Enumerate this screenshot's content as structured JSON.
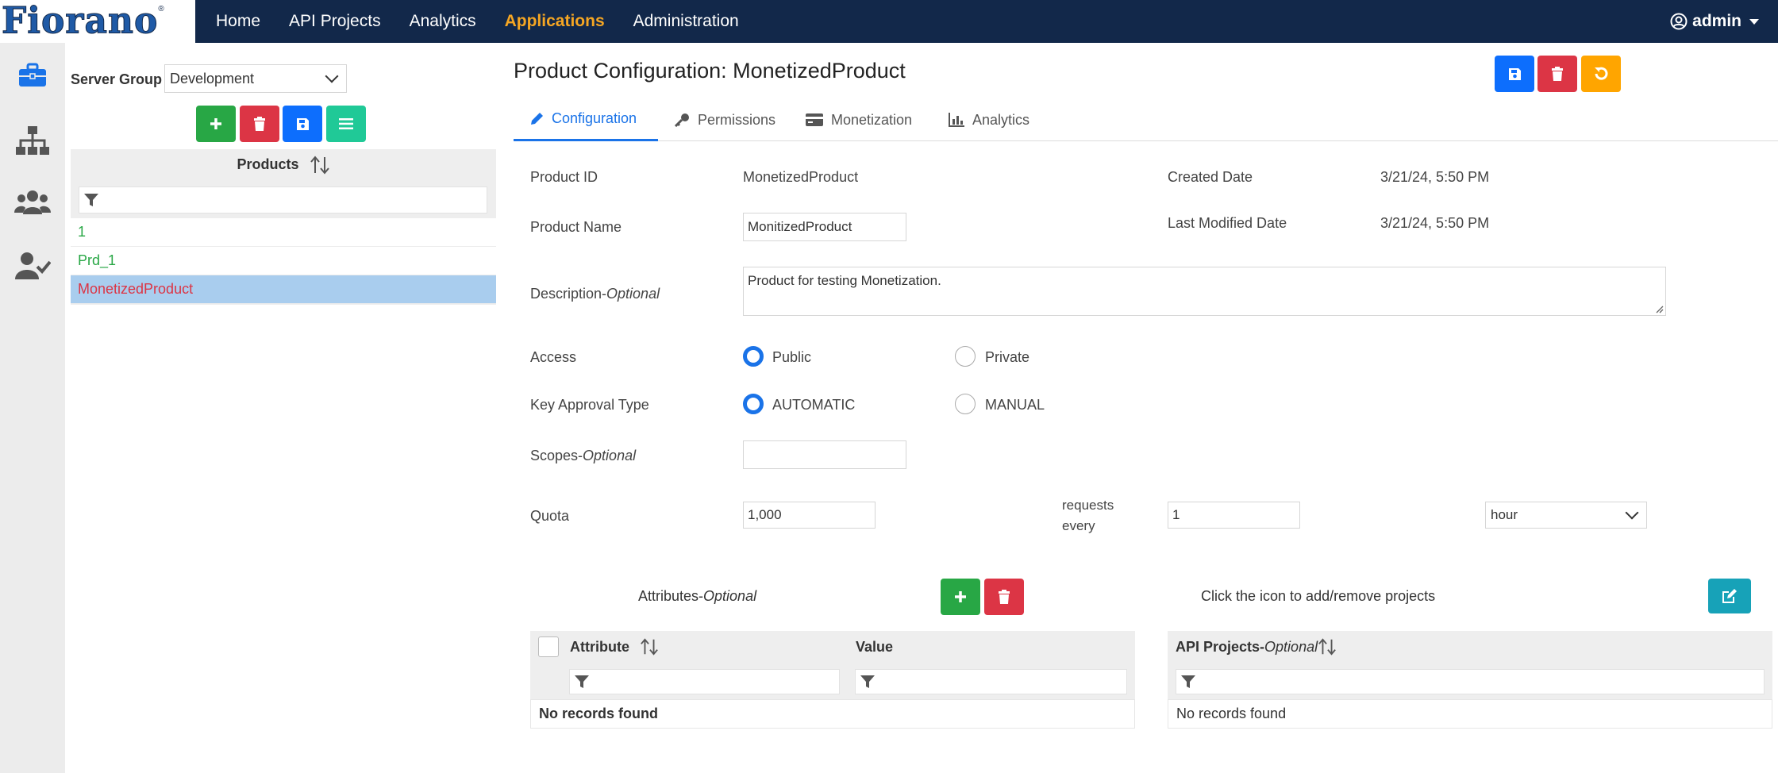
{
  "app": {
    "logo": "Fiorano",
    "logo_mark": "®"
  },
  "nav": {
    "items": [
      "Home",
      "API Projects",
      "Analytics",
      "Applications",
      "Administration"
    ],
    "active": "Applications",
    "user": "admin"
  },
  "sidebar": {
    "icons": [
      "briefcase-icon",
      "sitemap-icon",
      "users-icon",
      "user-check-icon"
    ]
  },
  "products_pane": {
    "server_group_label": "Server Group",
    "server_group_value": "Development",
    "list_title": "Products",
    "items": [
      "1",
      "Prd_1",
      "MonetizedProduct"
    ],
    "selected": "MonetizedProduct"
  },
  "main": {
    "title": "Product Configuration: MonetizedProduct",
    "tabs": [
      "Configuration",
      "Permissions",
      "Monetization",
      "Analytics"
    ],
    "active_tab": "Configuration",
    "form": {
      "product_id_label": "Product ID",
      "product_id_value": "MonetizedProduct",
      "created_date_label": "Created Date",
      "created_date_value": "3/21/24, 5:50 PM",
      "product_name_label": "Product Name",
      "product_name_value": "MonitizedProduct",
      "last_modified_label": "Last Modified Date",
      "last_modified_value": "3/21/24, 5:50 PM",
      "description_label": "Description-",
      "description_optional": "Optional",
      "description_value": "Product for testing Monetization.",
      "access_label": "Access",
      "access_options": [
        "Public",
        "Private"
      ],
      "access_selected": "Public",
      "key_approval_label": "Key Approval Type",
      "key_approval_options": [
        "AUTOMATIC",
        "MANUAL"
      ],
      "key_approval_selected": "AUTOMATIC",
      "scopes_label": "Scopes-",
      "scopes_optional": "Optional",
      "scopes_value": "",
      "quota_label": "Quota",
      "quota_value": "1,000",
      "requests_label_1": "requests",
      "requests_label_2": "every",
      "interval_value": "1",
      "interval_unit": "hour"
    },
    "attributes": {
      "title": "Attributes-",
      "optional": "Optional",
      "col_attribute": "Attribute",
      "col_value": "Value",
      "empty": "No records found"
    },
    "projects": {
      "hint": "Click the icon to add/remove projects",
      "col_title": "API Projects-",
      "optional": "Optional",
      "empty": "No records found"
    }
  },
  "colors": {
    "nav_bg": "#12284a",
    "active_nav": "#f5a623",
    "accent_blue": "#1a73e8",
    "green": "#28a745",
    "red": "#dc3545",
    "orange": "#ffa500",
    "teal": "#20c997",
    "cyan": "#17a2b8",
    "selected_row": "#a9cdee"
  }
}
